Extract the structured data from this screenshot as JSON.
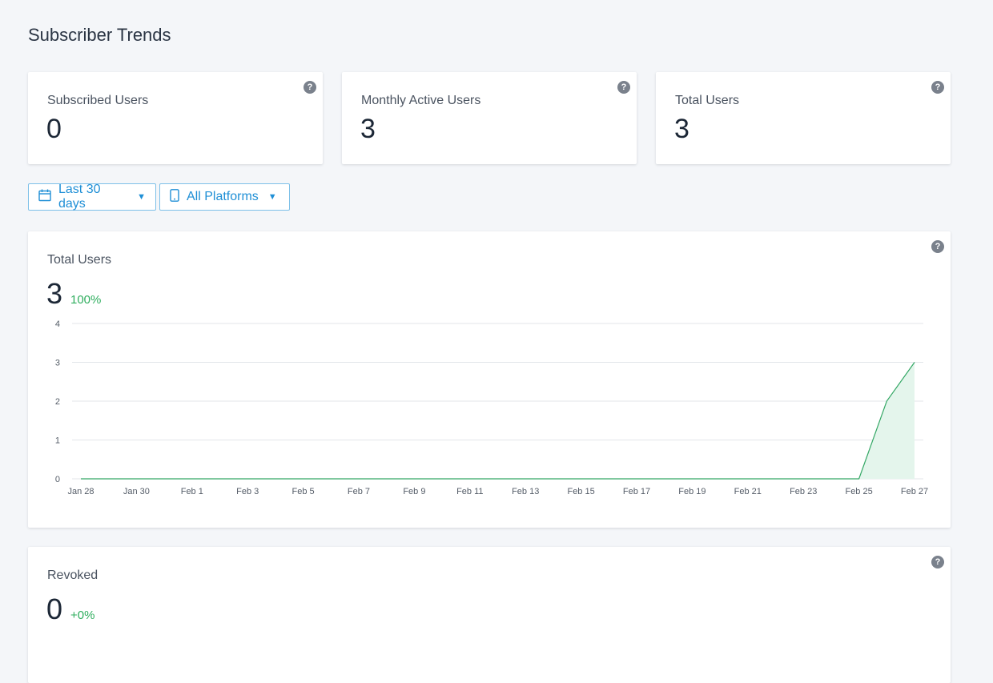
{
  "page": {
    "title": "Subscriber Trends"
  },
  "stats": [
    {
      "label": "Subscribed Users",
      "value": "0"
    },
    {
      "label": "Monthly Active Users",
      "value": "3"
    },
    {
      "label": "Total Users",
      "value": "3"
    }
  ],
  "help_glyph": "?",
  "filters": {
    "range": {
      "label": "Last 30 days",
      "icon": "calendar-icon"
    },
    "platform": {
      "label": "All Platforms",
      "icon": "mobile-phone-icon"
    },
    "caret": "▼"
  },
  "total_users_card": {
    "label": "Total Users",
    "value": "3",
    "delta": "100%"
  },
  "revoked_card": {
    "label": "Revoked",
    "value": "0",
    "delta": "+0%"
  },
  "colors": {
    "accent": "#1f8fd6",
    "positive": "#2fae5e",
    "line": "#35a866",
    "fill": "#e4f5ec"
  },
  "chart_data": {
    "type": "area",
    "x_tick_labels": [
      "Jan 28",
      "Jan 30",
      "Feb 1",
      "Feb 3",
      "Feb 5",
      "Feb 7",
      "Feb 9",
      "Feb 11",
      "Feb 13",
      "Feb 15",
      "Feb 17",
      "Feb 19",
      "Feb 21",
      "Feb 23",
      "Feb 25",
      "Feb 27"
    ],
    "x": [
      "2024-01-28",
      "2024-01-29",
      "2024-01-30",
      "2024-01-31",
      "2024-02-01",
      "2024-02-02",
      "2024-02-03",
      "2024-02-04",
      "2024-02-05",
      "2024-02-06",
      "2024-02-07",
      "2024-02-08",
      "2024-02-09",
      "2024-02-10",
      "2024-02-11",
      "2024-02-12",
      "2024-02-13",
      "2024-02-14",
      "2024-02-15",
      "2024-02-16",
      "2024-02-17",
      "2024-02-18",
      "2024-02-19",
      "2024-02-20",
      "2024-02-21",
      "2024-02-22",
      "2024-02-23",
      "2024-02-24",
      "2024-02-25",
      "2024-02-26",
      "2024-02-27"
    ],
    "series": [
      {
        "values": [
          0,
          0,
          0,
          0,
          0,
          0,
          0,
          0,
          0,
          0,
          0,
          0,
          0,
          0,
          0,
          0,
          0,
          0,
          0,
          0,
          0,
          0,
          0,
          0,
          0,
          0,
          0,
          0,
          0,
          2,
          3
        ]
      }
    ],
    "yticks": [
      0,
      1,
      2,
      3,
      4
    ],
    "ylim": [
      0,
      4
    ],
    "grid": true
  }
}
